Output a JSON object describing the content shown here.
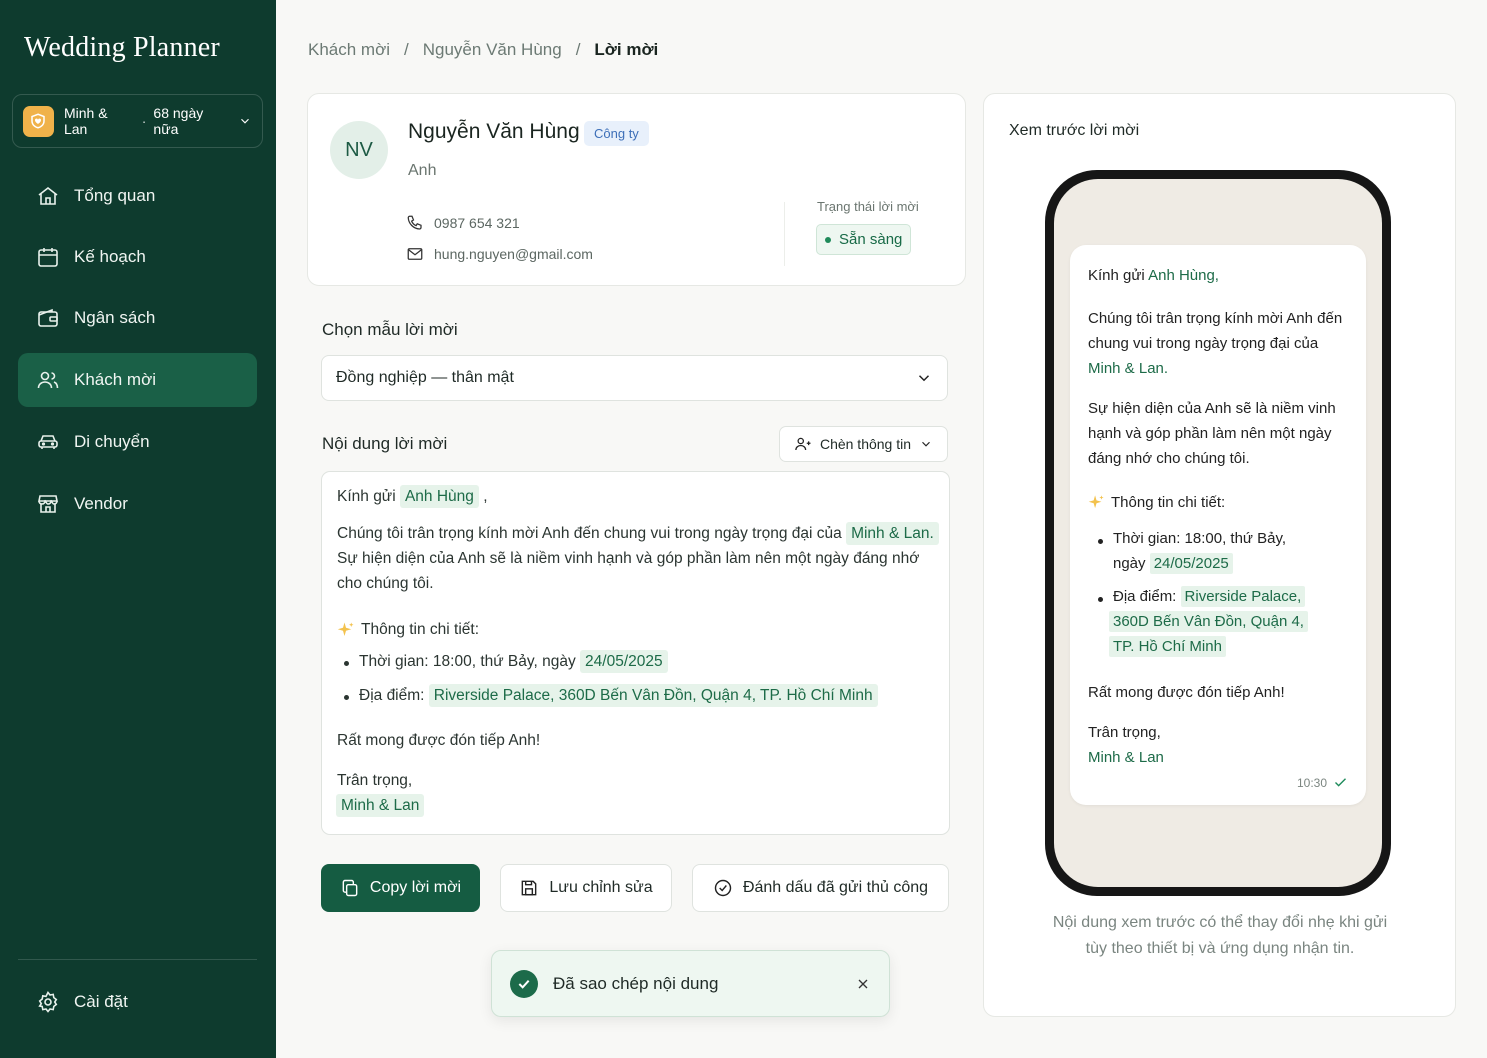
{
  "sidebar": {
    "brand": "Wedding Planner",
    "couple": {
      "names": "Minh & Lan",
      "countdown": "68 ngày nữa"
    },
    "items": [
      {
        "label": "Tổng quan",
        "icon": "home-icon"
      },
      {
        "label": "Kế hoạch",
        "icon": "calendar-icon"
      },
      {
        "label": "Ngân sách",
        "icon": "wallet-icon"
      },
      {
        "label": "Khách mời",
        "icon": "users-icon",
        "active": true
      },
      {
        "label": "Di chuyển",
        "icon": "car-icon"
      },
      {
        "label": "Vendor",
        "icon": "store-icon"
      }
    ],
    "settings": {
      "label": "Cài đặt",
      "icon": "gear-icon"
    }
  },
  "breadcrumb": [
    "Khách mời",
    "Nguyễn Văn Hùng",
    "Lời mời"
  ],
  "guest": {
    "initials": "NV",
    "name": "Nguyễn Văn Hùng",
    "tag": "Công ty",
    "relation": "Anh",
    "phone": "0987 654 321",
    "email": "hung.nguyen@gmail.com",
    "status_label": "Trạng thái lời mời",
    "status": "Sẵn sàng"
  },
  "template": {
    "label": "Chọn mẫu lời mời",
    "selected": "Đồng nghiệp — thân mật"
  },
  "content": {
    "label": "Nội dung lời mời",
    "insert_button": "Chèn thông tin",
    "greeting": "Kính gửi",
    "guest_var": "Anh Hùng",
    "greeting_end": ",",
    "para1": "Chúng tôi trân trọng kính mời Anh đến chung vui trong ngày trọng đại của",
    "couple_var": "Minh & Lan.",
    "para2a": "Sự hiện diện của Anh sẽ là niềm vinh hạnh và góp phần làm nên một ngày đáng nhớ",
    "para2b": "cho chúng tôi.",
    "details_heading": "Thông tin chi tiết:",
    "time_text": "Thời gian: 18:00, thứ Bảy, ngày",
    "date_var": "24/05/2025",
    "place_text": "Địa điểm:",
    "place_var": "Riverside Palace, 360D Bến Vân Đồn, Quận 4, TP. Hồ Chí Minh",
    "closing": "Rất mong được đón tiếp Anh!",
    "regards": "Trân trọng,",
    "signature_var": "Minh & Lan"
  },
  "actions": {
    "copy": "Copy lời mời",
    "save": "Lưu chỉnh sửa",
    "mark": "Đánh dấu đã gửi thủ công"
  },
  "toast": {
    "message": "Đã sao chép nội dung"
  },
  "preview": {
    "title": "Xem trước lời mời",
    "greeting": "Kính gửi",
    "guest": "Anh Hùng,",
    "p1a": "Chúng tôi trân trọng kính mời Anh đến",
    "p1b": "chung vui trong ngày trọng đại của",
    "couple": "Minh & Lan.",
    "p2a": "Sự hiện diện của Anh sẽ là niềm vinh",
    "p2b": "hạnh và góp phần làm nên một ngày",
    "p2c": "đáng nhớ cho chúng tôi.",
    "details": "Thông tin chi tiết:",
    "time1": "Thời gian: 18:00, thứ Bảy,",
    "time2": "ngày",
    "date": "24/05/2025",
    "place_label": "Địa điểm:",
    "place1": "Riverside Palace,",
    "place2": "360D Bến Vân Đồn, Quận 4,",
    "place3": "TP. Hồ Chí Minh",
    "closing": "Rất mong được đón tiếp Anh!",
    "regards": "Trân trọng,",
    "signature": "Minh & Lan",
    "time": "10:30",
    "note1": "Nội dung xem trước có thể thay đổi nhẹ khi gửi",
    "note2": "tùy theo thiết bị và ứng dụng nhận tin."
  },
  "colors": {
    "sidebar": "#0e3b2e",
    "accent": "#155c42",
    "highlight": "#e6f3ea",
    "badge": "#f0b24a"
  }
}
